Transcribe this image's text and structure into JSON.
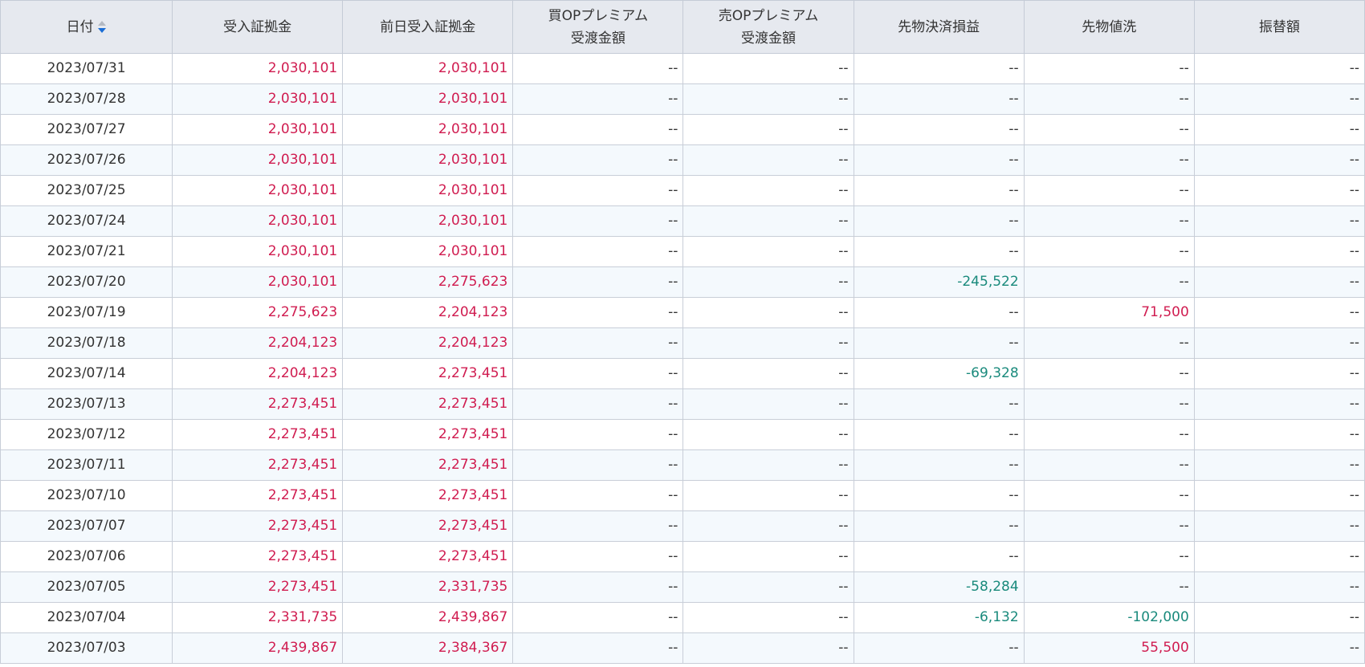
{
  "columns": [
    {
      "lines": [
        "日付"
      ],
      "sortable": true
    },
    {
      "lines": [
        "受入証拠金"
      ]
    },
    {
      "lines": [
        "前日受入証拠金"
      ]
    },
    {
      "lines": [
        "買OPプレミアム",
        "受渡金額"
      ]
    },
    {
      "lines": [
        "売OPプレミアム",
        "受渡金額"
      ]
    },
    {
      "lines": [
        "先物決済損益"
      ]
    },
    {
      "lines": [
        "先物値洗"
      ]
    },
    {
      "lines": [
        "振替額"
      ]
    }
  ],
  "colors": {
    "positive": "#d01c50",
    "negative": "#1a8a7c",
    "neutral": "#333333",
    "sort_active": "#1a6dd6",
    "header_bg": "#e6e9ef",
    "stripe_bg": "#f4f9fd"
  },
  "icons": {
    "sort": "sort-arrows-icon"
  },
  "rows": [
    [
      "2023/07/31",
      "2,030,101",
      "2,030,101",
      "--",
      "--",
      "--",
      "--",
      "--"
    ],
    [
      "2023/07/28",
      "2,030,101",
      "2,030,101",
      "--",
      "--",
      "--",
      "--",
      "--"
    ],
    [
      "2023/07/27",
      "2,030,101",
      "2,030,101",
      "--",
      "--",
      "--",
      "--",
      "--"
    ],
    [
      "2023/07/26",
      "2,030,101",
      "2,030,101",
      "--",
      "--",
      "--",
      "--",
      "--"
    ],
    [
      "2023/07/25",
      "2,030,101",
      "2,030,101",
      "--",
      "--",
      "--",
      "--",
      "--"
    ],
    [
      "2023/07/24",
      "2,030,101",
      "2,030,101",
      "--",
      "--",
      "--",
      "--",
      "--"
    ],
    [
      "2023/07/21",
      "2,030,101",
      "2,030,101",
      "--",
      "--",
      "--",
      "--",
      "--"
    ],
    [
      "2023/07/20",
      "2,030,101",
      "2,275,623",
      "--",
      "--",
      "-245,522",
      "--",
      "--"
    ],
    [
      "2023/07/19",
      "2,275,623",
      "2,204,123",
      "--",
      "--",
      "--",
      "71,500",
      "--"
    ],
    [
      "2023/07/18",
      "2,204,123",
      "2,204,123",
      "--",
      "--",
      "--",
      "--",
      "--"
    ],
    [
      "2023/07/14",
      "2,204,123",
      "2,273,451",
      "--",
      "--",
      "-69,328",
      "--",
      "--"
    ],
    [
      "2023/07/13",
      "2,273,451",
      "2,273,451",
      "--",
      "--",
      "--",
      "--",
      "--"
    ],
    [
      "2023/07/12",
      "2,273,451",
      "2,273,451",
      "--",
      "--",
      "--",
      "--",
      "--"
    ],
    [
      "2023/07/11",
      "2,273,451",
      "2,273,451",
      "--",
      "--",
      "--",
      "--",
      "--"
    ],
    [
      "2023/07/10",
      "2,273,451",
      "2,273,451",
      "--",
      "--",
      "--",
      "--",
      "--"
    ],
    [
      "2023/07/07",
      "2,273,451",
      "2,273,451",
      "--",
      "--",
      "--",
      "--",
      "--"
    ],
    [
      "2023/07/06",
      "2,273,451",
      "2,273,451",
      "--",
      "--",
      "--",
      "--",
      "--"
    ],
    [
      "2023/07/05",
      "2,273,451",
      "2,331,735",
      "--",
      "--",
      "-58,284",
      "--",
      "--"
    ],
    [
      "2023/07/04",
      "2,331,735",
      "2,439,867",
      "--",
      "--",
      "-6,132",
      "-102,000",
      "--"
    ],
    [
      "2023/07/03",
      "2,439,867",
      "2,384,367",
      "--",
      "--",
      "--",
      "55,500",
      "--"
    ]
  ]
}
